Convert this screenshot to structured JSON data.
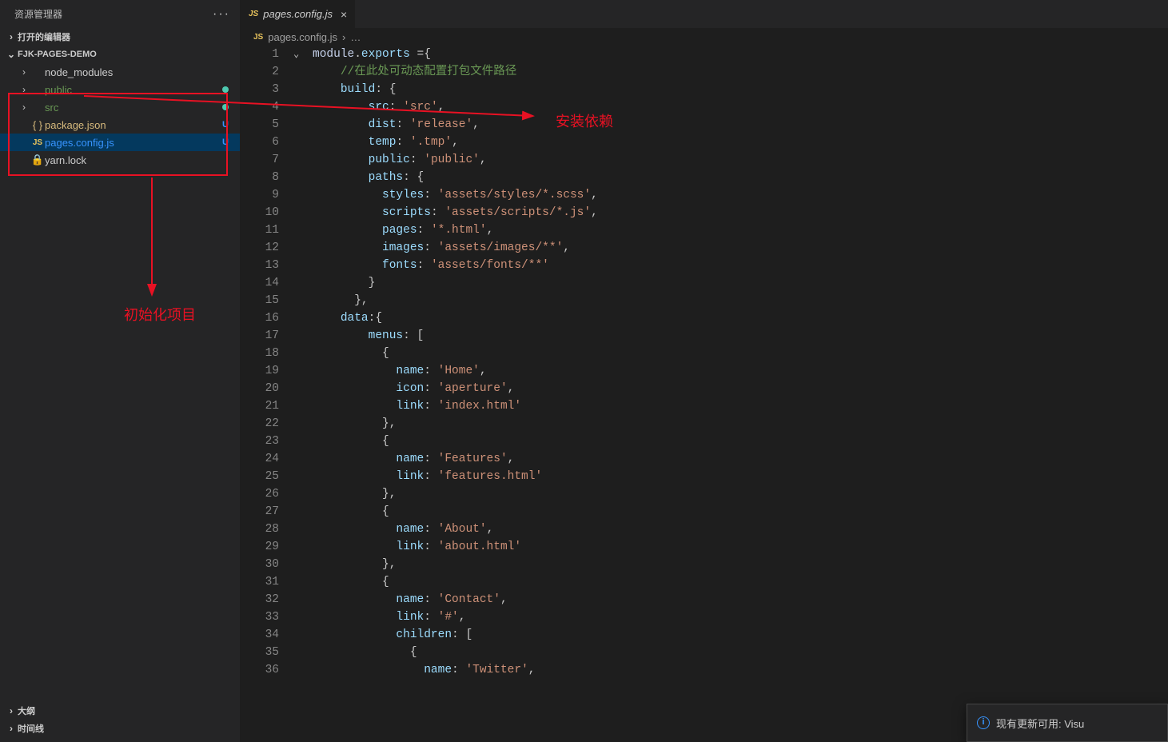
{
  "sidebar": {
    "title": "资源管理器",
    "sections": {
      "open_editors": "打开的编辑器",
      "project": "FJK-PAGES-DEMO",
      "outline": "大纲",
      "timeline": "时间线"
    },
    "files": [
      {
        "name": "node_modules",
        "kind": "folder",
        "indent": 1,
        "status": ""
      },
      {
        "name": "public",
        "kind": "folder",
        "indent": 1,
        "status": "dot",
        "color": "green"
      },
      {
        "name": "src",
        "kind": "folder",
        "indent": 1,
        "status": "dot",
        "color": "green"
      },
      {
        "name": "package.json",
        "kind": "json",
        "indent": 1,
        "status": "U",
        "color": "modified"
      },
      {
        "name": "pages.config.js",
        "kind": "js",
        "indent": 1,
        "status": "U",
        "color": "untracked",
        "selected": true
      },
      {
        "name": "yarn.lock",
        "kind": "lock",
        "indent": 1,
        "status": ""
      }
    ]
  },
  "annotations": {
    "init_project": "初始化项目",
    "install_deps": "安装依赖"
  },
  "tabs": [
    {
      "icon": "JS",
      "label": "pages.config.js",
      "active": true
    }
  ],
  "breadcrumb": {
    "icon": "JS",
    "file": "pages.config.js",
    "tail": "…"
  },
  "code": {
    "lines": [
      [
        [
          "var",
          "module"
        ],
        [
          "punc",
          "."
        ],
        [
          "prop",
          "exports"
        ],
        [
          "punc",
          " ="
        ],
        [
          "punc",
          "{"
        ]
      ],
      [
        [
          "sp",
          "    "
        ],
        [
          "cmnt",
          "//在此处可动态配置打包文件路径"
        ]
      ],
      [
        [
          "sp",
          "    "
        ],
        [
          "prop",
          "build"
        ],
        [
          "punc",
          ": {"
        ]
      ],
      [
        [
          "sp",
          "        "
        ],
        [
          "prop",
          "src"
        ],
        [
          "punc",
          ": "
        ],
        [
          "str",
          "'src'"
        ],
        [
          "punc",
          ","
        ]
      ],
      [
        [
          "sp",
          "        "
        ],
        [
          "prop",
          "dist"
        ],
        [
          "punc",
          ": "
        ],
        [
          "str",
          "'release'"
        ],
        [
          "punc",
          ","
        ]
      ],
      [
        [
          "sp",
          "        "
        ],
        [
          "prop",
          "temp"
        ],
        [
          "punc",
          ": "
        ],
        [
          "str",
          "'.tmp'"
        ],
        [
          "punc",
          ","
        ]
      ],
      [
        [
          "sp",
          "        "
        ],
        [
          "prop",
          "public"
        ],
        [
          "punc",
          ": "
        ],
        [
          "str",
          "'public'"
        ],
        [
          "punc",
          ","
        ]
      ],
      [
        [
          "sp",
          "        "
        ],
        [
          "prop",
          "paths"
        ],
        [
          "punc",
          ": {"
        ]
      ],
      [
        [
          "sp",
          "          "
        ],
        [
          "prop",
          "styles"
        ],
        [
          "punc",
          ": "
        ],
        [
          "str",
          "'assets/styles/*.scss'"
        ],
        [
          "punc",
          ","
        ]
      ],
      [
        [
          "sp",
          "          "
        ],
        [
          "prop",
          "scripts"
        ],
        [
          "punc",
          ": "
        ],
        [
          "str",
          "'assets/scripts/*.js'"
        ],
        [
          "punc",
          ","
        ]
      ],
      [
        [
          "sp",
          "          "
        ],
        [
          "prop",
          "pages"
        ],
        [
          "punc",
          ": "
        ],
        [
          "str",
          "'*.html'"
        ],
        [
          "punc",
          ","
        ]
      ],
      [
        [
          "sp",
          "          "
        ],
        [
          "prop",
          "images"
        ],
        [
          "punc",
          ": "
        ],
        [
          "str",
          "'assets/images/**'"
        ],
        [
          "punc",
          ","
        ]
      ],
      [
        [
          "sp",
          "          "
        ],
        [
          "prop",
          "fonts"
        ],
        [
          "punc",
          ": "
        ],
        [
          "str",
          "'assets/fonts/**'"
        ]
      ],
      [
        [
          "sp",
          "        "
        ],
        [
          "punc",
          "}"
        ]
      ],
      [
        [
          "sp",
          "      "
        ],
        [
          "punc",
          "},"
        ]
      ],
      [
        [
          "sp",
          "    "
        ],
        [
          "prop",
          "data"
        ],
        [
          "punc",
          ":"
        ],
        [
          "punc",
          "{"
        ]
      ],
      [
        [
          "sp",
          "        "
        ],
        [
          "prop",
          "menus"
        ],
        [
          "punc",
          ": ["
        ]
      ],
      [
        [
          "sp",
          "          "
        ],
        [
          "punc",
          "{"
        ]
      ],
      [
        [
          "sp",
          "            "
        ],
        [
          "prop",
          "name"
        ],
        [
          "punc",
          ": "
        ],
        [
          "str",
          "'Home'"
        ],
        [
          "punc",
          ","
        ]
      ],
      [
        [
          "sp",
          "            "
        ],
        [
          "prop",
          "icon"
        ],
        [
          "punc",
          ": "
        ],
        [
          "str",
          "'aperture'"
        ],
        [
          "punc",
          ","
        ]
      ],
      [
        [
          "sp",
          "            "
        ],
        [
          "prop",
          "link"
        ],
        [
          "punc",
          ": "
        ],
        [
          "str",
          "'index.html'"
        ]
      ],
      [
        [
          "sp",
          "          "
        ],
        [
          "punc",
          "},"
        ]
      ],
      [
        [
          "sp",
          "          "
        ],
        [
          "punc",
          "{"
        ]
      ],
      [
        [
          "sp",
          "            "
        ],
        [
          "prop",
          "name"
        ],
        [
          "punc",
          ": "
        ],
        [
          "str",
          "'Features'"
        ],
        [
          "punc",
          ","
        ]
      ],
      [
        [
          "sp",
          "            "
        ],
        [
          "prop",
          "link"
        ],
        [
          "punc",
          ": "
        ],
        [
          "str",
          "'features.html'"
        ]
      ],
      [
        [
          "sp",
          "          "
        ],
        [
          "punc",
          "},"
        ]
      ],
      [
        [
          "sp",
          "          "
        ],
        [
          "punc",
          "{"
        ]
      ],
      [
        [
          "sp",
          "            "
        ],
        [
          "prop",
          "name"
        ],
        [
          "punc",
          ": "
        ],
        [
          "str",
          "'About'"
        ],
        [
          "punc",
          ","
        ]
      ],
      [
        [
          "sp",
          "            "
        ],
        [
          "prop",
          "link"
        ],
        [
          "punc",
          ": "
        ],
        [
          "str",
          "'about.html'"
        ]
      ],
      [
        [
          "sp",
          "          "
        ],
        [
          "punc",
          "},"
        ]
      ],
      [
        [
          "sp",
          "          "
        ],
        [
          "punc",
          "{"
        ]
      ],
      [
        [
          "sp",
          "            "
        ],
        [
          "prop",
          "name"
        ],
        [
          "punc",
          ": "
        ],
        [
          "str",
          "'Contact'"
        ],
        [
          "punc",
          ","
        ]
      ],
      [
        [
          "sp",
          "            "
        ],
        [
          "prop",
          "link"
        ],
        [
          "punc",
          ": "
        ],
        [
          "str",
          "'#'"
        ],
        [
          "punc",
          ","
        ]
      ],
      [
        [
          "sp",
          "            "
        ],
        [
          "prop",
          "children"
        ],
        [
          "punc",
          ": ["
        ]
      ],
      [
        [
          "sp",
          "              "
        ],
        [
          "punc",
          "{"
        ]
      ],
      [
        [
          "sp",
          "                "
        ],
        [
          "prop",
          "name"
        ],
        [
          "punc",
          ": "
        ],
        [
          "str",
          "'Twitter'"
        ],
        [
          "punc",
          ","
        ]
      ]
    ],
    "start_line": 1
  },
  "popup": {
    "text": "现有更新可用: Visu"
  }
}
